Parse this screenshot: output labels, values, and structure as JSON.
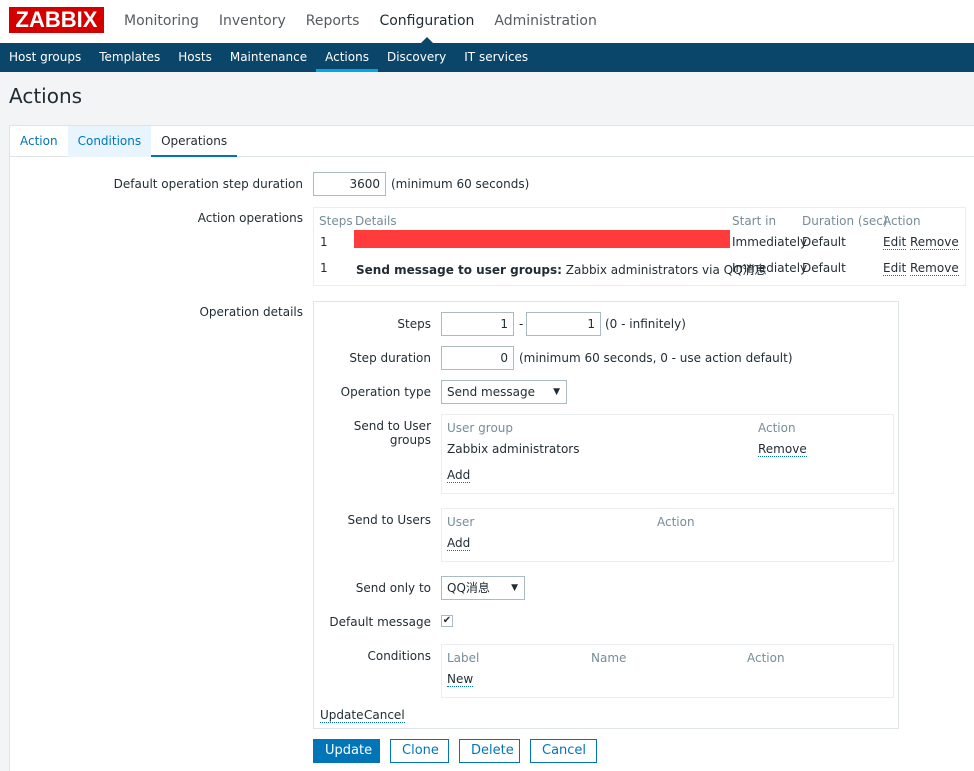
{
  "logo": "ZABBIX",
  "top_menu": [
    "Monitoring",
    "Inventory",
    "Reports",
    "Configuration",
    "Administration"
  ],
  "top_menu_selected": "Configuration",
  "sub_menu": [
    "Host groups",
    "Templates",
    "Hosts",
    "Maintenance",
    "Actions",
    "Discovery",
    "IT services"
  ],
  "sub_menu_selected": "Actions",
  "page_title": "Actions",
  "tabs": [
    "Action",
    "Conditions",
    "Operations"
  ],
  "form": {
    "step_duration_label": "Default operation step duration",
    "step_duration_value": "3600",
    "step_duration_hint": "(minimum 60 seconds)",
    "action_operations_label": "Action operations",
    "ops_headers": {
      "steps": "Steps",
      "details": "Details",
      "start_in": "Start in",
      "duration": "Duration (sec)",
      "action": "Action"
    },
    "ops_rows": [
      {
        "step": "1",
        "details_bold": "",
        "details_rest": "",
        "start_in": "Immediately",
        "duration": "Default",
        "edit": "Edit",
        "remove": "Remove"
      },
      {
        "step": "1",
        "details_bold": "Send message to user groups:",
        "details_rest": " Zabbix administrators via QQ消息",
        "start_in": "Immediately",
        "duration": "Default",
        "edit": "Edit",
        "remove": "Remove"
      }
    ],
    "operation_details_label": "Operation details",
    "details": {
      "steps_label": "Steps",
      "steps_from": "1",
      "steps_sep": "-",
      "steps_to": "1",
      "steps_hint": "(0 - infinitely)",
      "step_duration_label": "Step duration",
      "step_duration_value": "0",
      "step_duration_hint": "(minimum 60 seconds, 0 - use action default)",
      "op_type_label": "Operation type",
      "op_type_value": "Send message",
      "send_groups_label": "Send to User groups",
      "groups_header_group": "User group",
      "groups_header_action": "Action",
      "groups_row_name": "Zabbix administrators",
      "groups_row_remove": "Remove",
      "groups_add": "Add",
      "send_users_label": "Send to Users",
      "users_header_user": "User",
      "users_header_action": "Action",
      "users_add": "Add",
      "send_only_label": "Send only to",
      "send_only_value": "QQ消息",
      "default_msg_label": "Default message",
      "default_msg_checked": "✔",
      "conditions_label": "Conditions",
      "cond_header_label": "Label",
      "cond_header_name": "Name",
      "cond_header_action": "Action",
      "cond_new": "New",
      "update_link": "Update",
      "cancel_link": "Cancel"
    },
    "buttons": {
      "update": "Update",
      "clone": "Clone",
      "delete": "Delete",
      "cancel": "Cancel"
    }
  },
  "colors": {
    "brand_red": "#d40000",
    "nav_blue": "#0a466a",
    "accent": "#0275b8",
    "redaction": "#ff3b3b"
  }
}
